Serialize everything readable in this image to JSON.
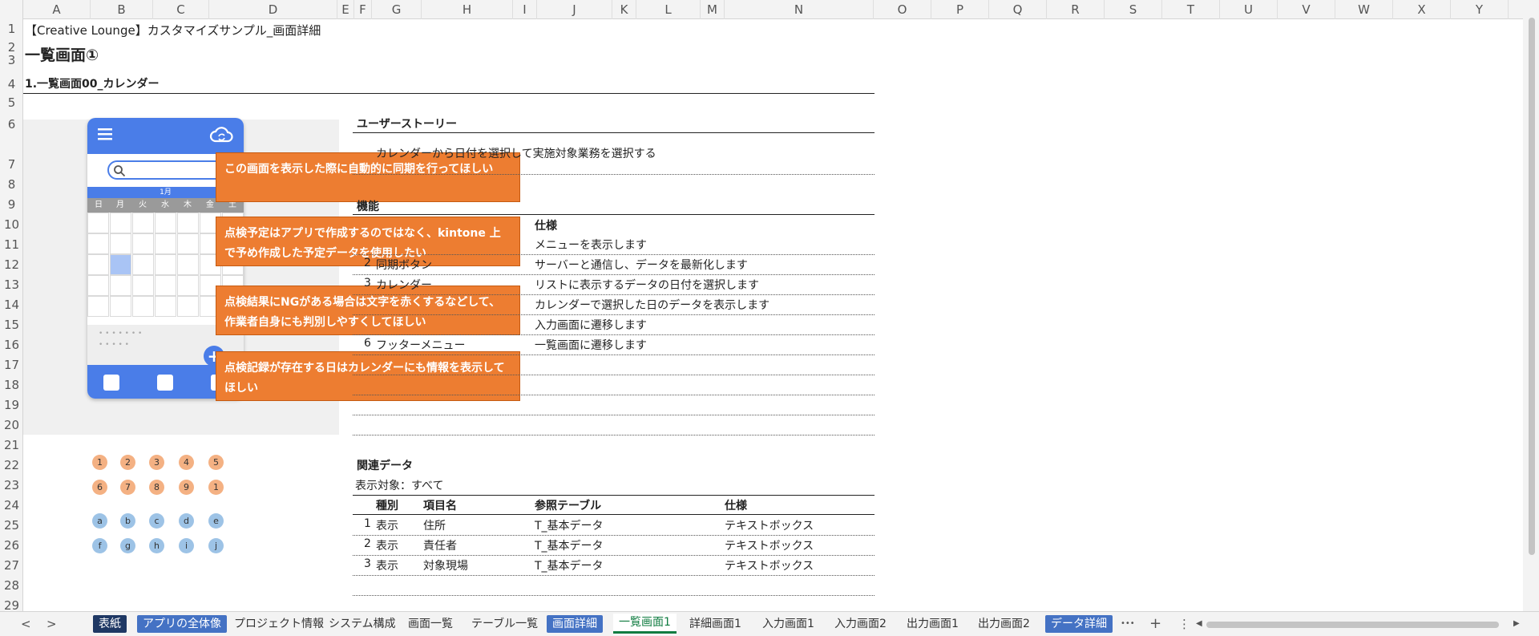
{
  "columns": [
    "A",
    "B",
    "C",
    "D",
    "E",
    "F",
    "G",
    "H",
    "I",
    "J",
    "K",
    "L",
    "M",
    "N",
    "O",
    "P",
    "Q",
    "R",
    "S",
    "T",
    "U",
    "V",
    "W",
    "X",
    "Y"
  ],
  "rows": [
    "1",
    "2",
    "3",
    "4",
    "5",
    "6",
    "7",
    "8",
    "9",
    "10",
    "11",
    "12",
    "13",
    "14",
    "15",
    "16",
    "17",
    "18",
    "19",
    "20",
    "21",
    "22",
    "23",
    "24",
    "25",
    "26",
    "27",
    "28",
    "29"
  ],
  "doc": {
    "title": "【Creative Lounge】カスタマイズサンプル_画面詳細",
    "heading": "一覧画面①",
    "section": "1.一覧画面00_カレンダー"
  },
  "phone": {
    "month": "1月",
    "weekdays": [
      "日",
      "月",
      "火",
      "水",
      "木",
      "金",
      "土"
    ],
    "fab": "+",
    "list_dots_1": "• • • • • • •",
    "list_dots_2": "• • • • •"
  },
  "callouts": [
    "この画面を表示した際に自動的に同期を行ってほしい",
    "点検予定はアプリで作成するのではなく、kintone 上で予め作成した予定データを使用したい",
    "点検結果にNGがある場合は文字を赤くするなどして、作業者自身にも判別しやすくしてほしい",
    "点検記録が存在する日はカレンダーにも情報を表示してほしい"
  ],
  "circles_orange": [
    "1",
    "2",
    "3",
    "4",
    "5",
    "6",
    "7",
    "8",
    "9",
    "1"
  ],
  "circles_blue": [
    "a",
    "b",
    "c",
    "d",
    "e",
    "f",
    "g",
    "h",
    "i",
    "j"
  ],
  "story": {
    "title": "ユーザーストーリー",
    "text": "カレンダーから日付を選択して実施対象業務を選択する"
  },
  "features": {
    "title": "機能",
    "spec_header": "仕様",
    "rows": [
      {
        "num": "",
        "name": "",
        "spec": "メニューを表示します"
      },
      {
        "num": "2",
        "name": "同期ボタン",
        "spec": "サーバーと通信し、データを最新化します"
      },
      {
        "num": "3",
        "name": "カレンダー",
        "spec": "リストに表示するデータの日付を選択します"
      },
      {
        "num": "",
        "name": "",
        "spec": "カレンダーで選択した日のデータを表示します"
      },
      {
        "num": "",
        "name": "",
        "spec": "入力画面に遷移します"
      },
      {
        "num": "6",
        "name": "フッターメニュー",
        "spec": "一覧画面に遷移します"
      }
    ]
  },
  "related": {
    "title": "関連データ",
    "target": "表示対象：すべて",
    "headers": [
      "種別",
      "項目名",
      "参照テーブル",
      "仕様"
    ],
    "rows": [
      {
        "num": "1",
        "type": "表示",
        "name": "住所",
        "table": "T_基本データ",
        "spec": "テキストボックス"
      },
      {
        "num": "2",
        "type": "表示",
        "name": "責任者",
        "table": "T_基本データ",
        "spec": "テキストボックス"
      },
      {
        "num": "3",
        "type": "表示",
        "name": "対象現場",
        "table": "T_基本データ",
        "spec": "テキストボックス"
      }
    ]
  },
  "tabs": [
    {
      "label": "表紙",
      "style": "navy"
    },
    {
      "label": "アプリの全体像",
      "style": "blue"
    },
    {
      "label": "プロジェクト情報",
      "style": "plain"
    },
    {
      "label": "システム構成",
      "style": "plain"
    },
    {
      "label": "画面一覧",
      "style": "plain"
    },
    {
      "label": "テーブル一覧",
      "style": "plain"
    },
    {
      "label": "画面詳細",
      "style": "blue"
    },
    {
      "label": "一覧画面1",
      "style": "active"
    },
    {
      "label": "詳細画面1",
      "style": "plain"
    },
    {
      "label": "入力画面1",
      "style": "plain"
    },
    {
      "label": "入力画面2",
      "style": "plain"
    },
    {
      "label": "出力画面1",
      "style": "plain"
    },
    {
      "label": "出力画面2",
      "style": "plain"
    },
    {
      "label": "データ詳細",
      "style": "blue"
    }
  ],
  "tab_controls": {
    "prev": "<",
    "next": ">",
    "more": "•••",
    "add": "+",
    "menu": "⋮",
    "scroll_left": "◀",
    "scroll_right": "▶"
  }
}
